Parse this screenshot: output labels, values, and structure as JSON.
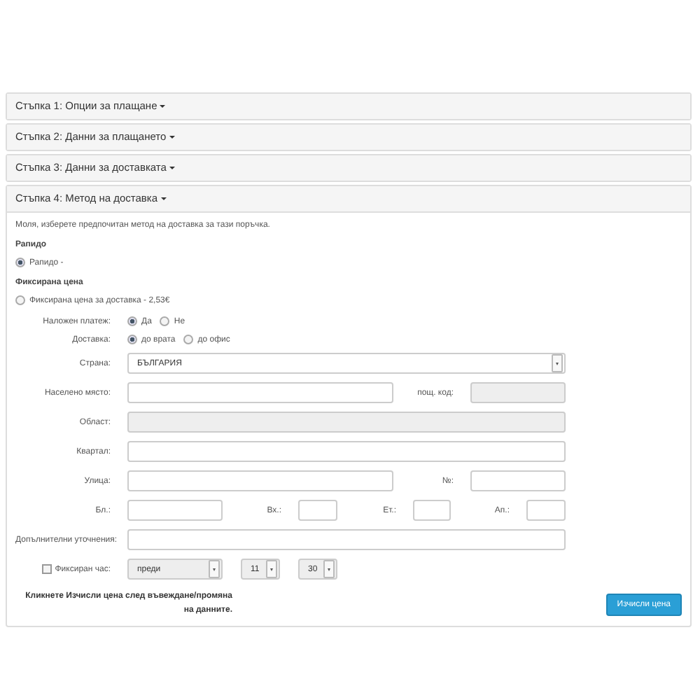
{
  "steps": [
    {
      "label": "Стъпка 1: Опции за плащане",
      "expanded": false
    },
    {
      "label": "Стъпка 2: Данни за плащането",
      "expanded": false
    },
    {
      "label": "Стъпка 3: Данни за доставката",
      "expanded": false
    },
    {
      "label": "Стъпка 4: Метод на доставка",
      "expanded": true
    }
  ],
  "instruction": "Моля, изберете предпочитан метод на доставка за тази поръчка.",
  "shipping_methods": [
    {
      "heading": "Рапидо",
      "option": "Рапидо -",
      "selected": true
    },
    {
      "heading": "Фиксирана цена",
      "option": "Фиксирана цена за доставка - 2,53€",
      "selected": false
    }
  ],
  "form_rows": [
    {
      "kind": "radio",
      "label": "Наложен платеж:",
      "options": [
        {
          "label": "Да",
          "selected": true
        },
        {
          "label": "Не",
          "selected": false
        }
      ]
    },
    {
      "kind": "radio",
      "label": "Доставка:",
      "options": [
        {
          "label": "до врата",
          "selected": true
        },
        {
          "label": "до офис",
          "selected": false
        }
      ]
    },
    {
      "kind": "select",
      "label": "Страна:",
      "value": "БЪЛГАРИЯ"
    },
    {
      "kind": "inputs",
      "fields": [
        {
          "label": "Населено място:",
          "disabled": false
        },
        {
          "label": "пощ. код:",
          "disabled": true
        }
      ]
    },
    {
      "kind": "inputs",
      "fields": [
        {
          "label": "Област:",
          "disabled": true
        }
      ]
    },
    {
      "kind": "inputs",
      "fields": [
        {
          "label": "Квартал:",
          "disabled": false
        }
      ]
    },
    {
      "kind": "inputs",
      "fields": [
        {
          "label": "Улица:",
          "disabled": false
        },
        {
          "label": "№:",
          "disabled": false
        }
      ]
    },
    {
      "kind": "inputs",
      "fields": [
        {
          "label": "Бл.:",
          "disabled": false
        },
        {
          "label": "Вх.:",
          "disabled": false
        },
        {
          "label": "Ет.:",
          "disabled": false
        },
        {
          "label": "Ап.:",
          "disabled": false
        }
      ]
    },
    {
      "kind": "inputs",
      "fields": [
        {
          "label": "Допълнителни уточнения:",
          "disabled": false
        }
      ]
    },
    {
      "kind": "time",
      "label": "Фиксиран час:",
      "checked": false,
      "selects": [
        "преди",
        "11",
        "30"
      ]
    }
  ],
  "note": "Кликнете Изчисли цена след въвеждане/промяна на данните.",
  "button": "Изчисли цена"
}
